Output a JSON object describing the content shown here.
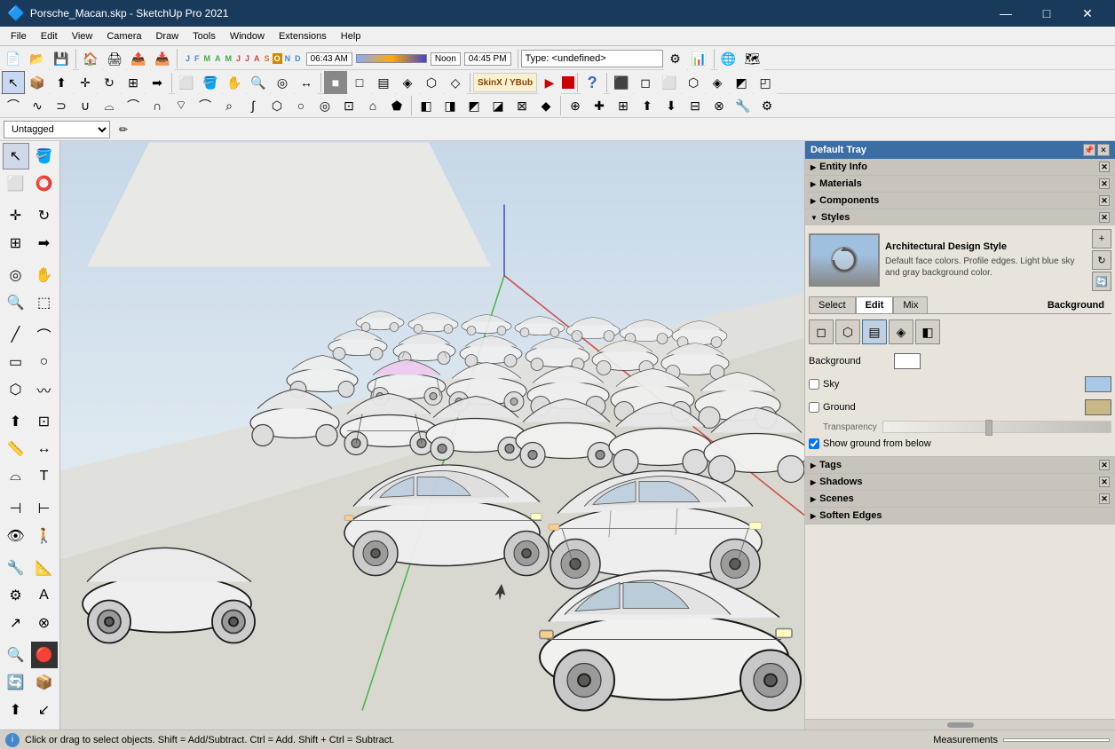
{
  "titleBar": {
    "icon": "🔷",
    "title": "Porsche_Macan.skp - SketchUp Pro 2021",
    "minimize": "—",
    "maximize": "□",
    "close": "✕"
  },
  "menuBar": {
    "items": [
      "File",
      "Edit",
      "View",
      "Camera",
      "Draw",
      "Tools",
      "Window",
      "Extensions",
      "Help"
    ]
  },
  "toolbar1": {
    "timeLeft": "06:43 AM",
    "timeMiddle": "Noon",
    "timeRight": "04:45 PM",
    "months": [
      "J",
      "F",
      "M",
      "A",
      "M",
      "J",
      "J",
      "A",
      "S",
      "O",
      "N",
      "D"
    ],
    "typeLabel": "Type: <undefined>"
  },
  "tagBar": {
    "tagLabel": "Untagged"
  },
  "tray": {
    "title": "Default Tray",
    "pinIcon": "📌"
  },
  "panels": {
    "entityInfo": {
      "label": "Entity Info",
      "collapsed": true
    },
    "materials": {
      "label": "Materials",
      "collapsed": true
    },
    "components": {
      "label": "Components",
      "collapsed": true
    },
    "styles": {
      "label": "Styles",
      "expanded": true,
      "styleName": "Architectural Design Style",
      "styleDesc": "Default face colors. Profile edges. Light blue sky and gray background color.",
      "tabs": {
        "select": "Select",
        "edit": "Edit",
        "mix": "Mix"
      },
      "activeTab": "Edit",
      "activeTabLabel": "Background"
    },
    "tags": {
      "label": "Tags",
      "collapsed": true
    },
    "shadows": {
      "label": "Shadows",
      "collapsed": true
    },
    "scenes": {
      "label": "Scenes",
      "collapsed": true
    },
    "softenEdges": {
      "label": "Soften Edges",
      "collapsed": true
    }
  },
  "background": {
    "backgroundLabel": "Background",
    "backgroundColor": "#ffffff",
    "skyLabel": "Sky",
    "skyChecked": false,
    "skyColor": "#a8c8e8",
    "groundLabel": "Ground",
    "groundChecked": false,
    "groundColor": "#c8b888",
    "transparencyLabel": "Transparency",
    "showGroundLabel": "Show ground from below",
    "showGroundChecked": true
  },
  "statusBar": {
    "infoIcon": "i",
    "message": "Click or drag to select objects. Shift = Add/Subtract. Ctrl = Add. Shift + Ctrl = Subtract.",
    "measurementsLabel": "Measurements"
  },
  "icons": {
    "arrow": "↖",
    "paint": "🪣",
    "eraser": "⬜",
    "eye": "👁",
    "rotate": "↻",
    "move": "✛",
    "scale": "⊞",
    "zoom": "🔍",
    "orbit": "◎",
    "pan": "✋",
    "push": "⬆",
    "line": "╱",
    "rectangle": "▭",
    "circle": "○",
    "arc": "⌒",
    "polygon": "⬡",
    "text": "T",
    "tape": "📏",
    "dimension": "↔",
    "protractor": "⌓"
  }
}
